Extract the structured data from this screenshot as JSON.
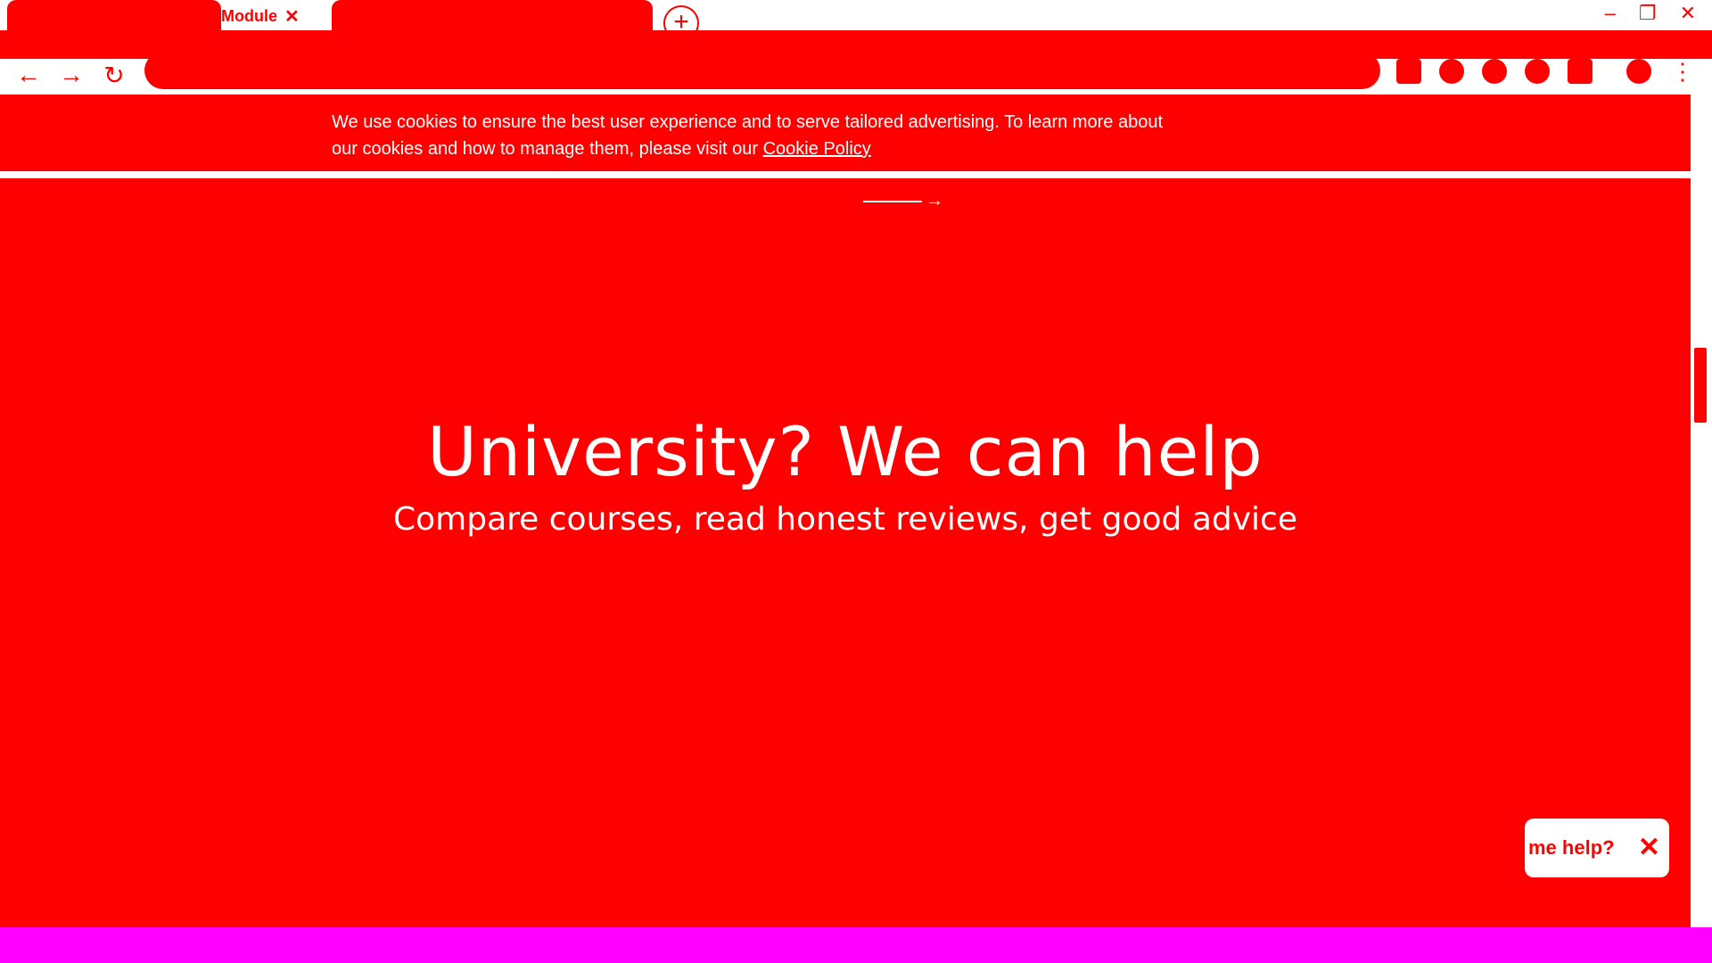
{
  "browser": {
    "tab_active_label": "Module",
    "tab_close_glyph": "✕",
    "new_tab_glyph": "+",
    "window_controls": {
      "minimize": "–",
      "maximize": "❐",
      "close": "✕"
    },
    "nav": {
      "back": "←",
      "forward": "→",
      "reload": "↻"
    },
    "menu_glyph": "⋮"
  },
  "cookie_banner": {
    "text": "We use cookies to ensure the best user experience and to serve tailored advertising. To learn more about our cookies and how to manage them, please visit our ",
    "link": "Cookie Policy"
  },
  "hero": {
    "arrow_glyph": "→",
    "title": "University? We can help",
    "subtitle": "Compare courses, read honest reviews, get good advice"
  },
  "help_widget": {
    "label": "me help?",
    "close_glyph": "✕"
  },
  "colors": {
    "accent": "#ff0000",
    "white": "#ffffff",
    "bottom_bar": "#ff00ff"
  }
}
